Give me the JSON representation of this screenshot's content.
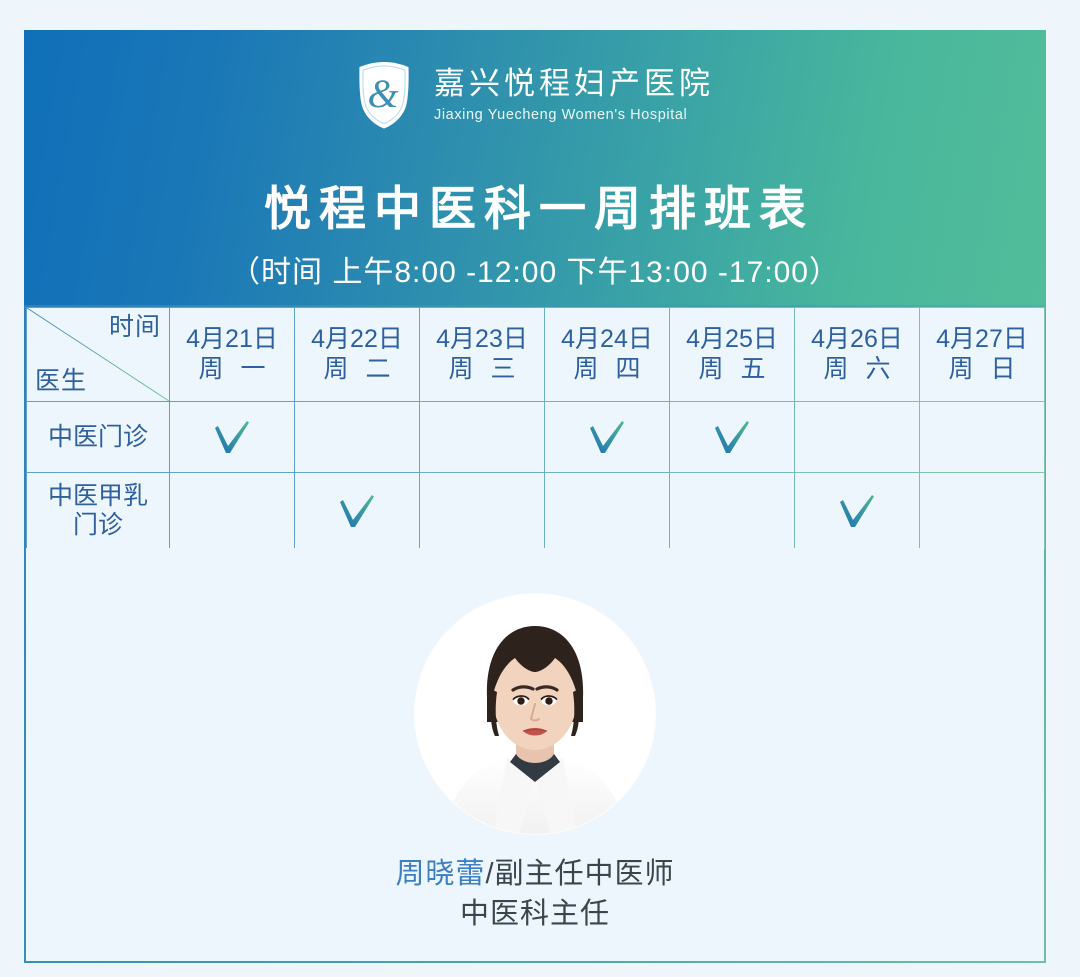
{
  "colors": {
    "banner_left": "#0f6fb8",
    "banner_right": "#52bd9a",
    "page_bg": "#eef5fb",
    "cell_bg": "#edf6fc",
    "table_text": "#2e5f9e",
    "doctor_name": "#3d7fc1",
    "doctor_title": "#3b4550",
    "check_start": "#1f6fb5",
    "check_end": "#4fba93"
  },
  "header": {
    "logo_icon": "shield-ampersand-icon",
    "hospital_cn": "嘉兴悦程妇产医院",
    "hospital_en": "Jiaxing Yuecheng Women's Hospital",
    "title": "悦程中医科一周排班表",
    "subtitle": "（时间 上午8:00 -12:00  下午13:00 -17:00）"
  },
  "table": {
    "corner": {
      "top_right": "时间",
      "bottom_left": "医生"
    },
    "columns": [
      {
        "date": "4月21日",
        "weekday": "周 一"
      },
      {
        "date": "4月22日",
        "weekday": "周 二"
      },
      {
        "date": "4月23日",
        "weekday": "周 三"
      },
      {
        "date": "4月24日",
        "weekday": "周 四"
      },
      {
        "date": "4月25日",
        "weekday": "周 五"
      },
      {
        "date": "4月26日",
        "weekday": "周 六"
      },
      {
        "date": "4月27日",
        "weekday": "周 日"
      }
    ],
    "rows": [
      {
        "label": "中医门诊",
        "label_line1": "中医门诊",
        "label_line2": "",
        "marks": [
          true,
          false,
          false,
          true,
          true,
          false,
          false
        ]
      },
      {
        "label": "中医甲乳门诊",
        "label_line1": "中医甲乳",
        "label_line2": "门诊",
        "marks": [
          false,
          true,
          false,
          false,
          false,
          true,
          false
        ]
      }
    ],
    "mark_icon": "check-icon"
  },
  "doctor": {
    "avatar_icon": "doctor-portrait-avatar",
    "name": "周晓蕾",
    "separator": "/",
    "title": "副主任中医师",
    "role": "中医科主任"
  }
}
